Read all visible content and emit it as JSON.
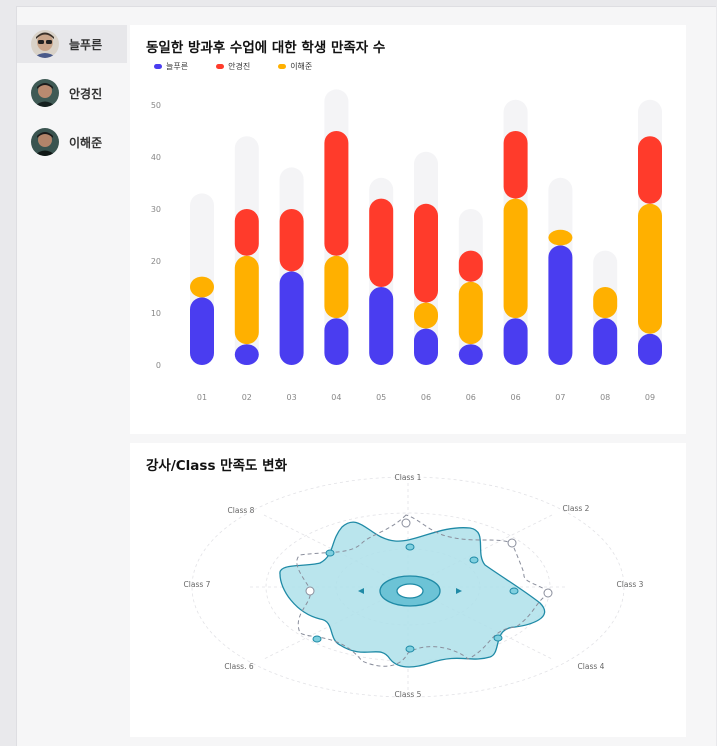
{
  "sidebar": {
    "users": [
      {
        "name": "늘푸른",
        "active": true
      },
      {
        "name": "안경진",
        "active": false
      },
      {
        "name": "이해준",
        "active": false
      }
    ]
  },
  "chart_data": [
    {
      "type": "bar",
      "title": "동일한 방과후 수업에 대한 학생 만족자 수",
      "categories": [
        "01",
        "02",
        "03",
        "04",
        "05",
        "06",
        "06",
        "06",
        "07",
        "08",
        "09"
      ],
      "ylim": [
        0,
        50
      ],
      "y_ticks": [
        "0",
        "10",
        "20",
        "30",
        "40",
        "50"
      ],
      "stacked": true,
      "series": [
        {
          "name": "늘푸른",
          "color": "#4a3df0",
          "values": [
            13,
            4,
            18,
            9,
            15,
            7,
            4,
            9,
            23,
            9,
            6
          ]
        },
        {
          "name": "이해준",
          "color": "#ffb000",
          "values": [
            4,
            17,
            0,
            12,
            0,
            5,
            12,
            23,
            3,
            6,
            25
          ]
        },
        {
          "name": "안경진",
          "color": "#ff3b2b",
          "values": [
            0,
            9,
            12,
            24,
            17,
            19,
            6,
            13,
            0,
            0,
            13
          ]
        }
      ],
      "background_totals": [
        33,
        44,
        38,
        53,
        36,
        41,
        30,
        51,
        36,
        22,
        51
      ],
      "legend": [
        "늘푸른",
        "안경진",
        "이해준"
      ],
      "legend_colors": [
        "#4a3df0",
        "#ff3b2b",
        "#ffb000"
      ]
    },
    {
      "type": "radar",
      "title": "강사/Class 만족도 변화",
      "axes": [
        "Class 1",
        "Class 2",
        "Class 3",
        "Class 4",
        "Class 5",
        "Class. 6",
        "Class 7",
        "Class 8"
      ]
    }
  ]
}
